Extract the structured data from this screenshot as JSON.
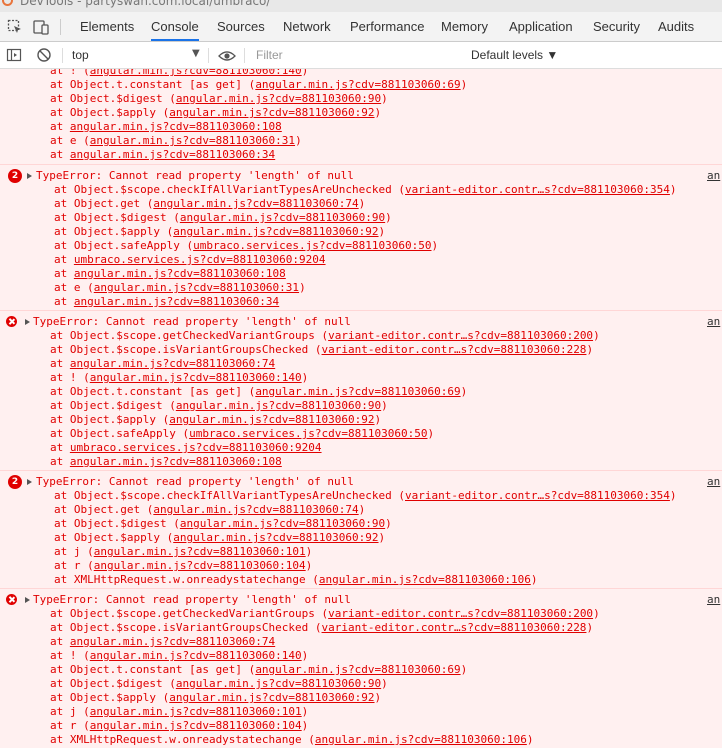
{
  "window": {
    "title": "DevTools - partyswan.com.local/umbraco/"
  },
  "tabs": [
    {
      "label": "Elements",
      "active": false
    },
    {
      "label": "Console",
      "active": true
    },
    {
      "label": "Sources",
      "active": false
    },
    {
      "label": "Network",
      "active": false
    },
    {
      "label": "Performance",
      "active": false
    },
    {
      "label": "Memory",
      "active": false
    },
    {
      "label": "Application",
      "active": false
    },
    {
      "label": "Security",
      "active": false
    },
    {
      "label": "Audits",
      "active": false
    }
  ],
  "toolbar": {
    "context": "top",
    "filter_placeholder": "Filter",
    "levels": "Default levels ▼"
  },
  "src_link": "an",
  "top_lines": [
    "at ! (angular.min.js?cdv=881103060:140)",
    "at Object.t.constant [as get] (angular.min.js?cdv=881103060:69)",
    "at Object.$digest (angular.min.js?cdv=881103060:90)",
    "at Object.$apply (angular.min.js?cdv=881103060:92)",
    "at angular.min.js?cdv=881103060:108",
    "at e (angular.min.js?cdv=881103060:31)",
    "at angular.min.js?cdv=881103060:34"
  ],
  "messages": [
    {
      "count": "2",
      "error": "TypeError: Cannot read property 'length' of null",
      "stack": [
        "at Object.$scope.checkIfAllVariantTypesAreUnchecked (variant-editor.contr…s?cdv=881103060:354)",
        "at Object.get (angular.min.js?cdv=881103060:74)",
        "at Object.$digest (angular.min.js?cdv=881103060:90)",
        "at Object.$apply (angular.min.js?cdv=881103060:92)",
        "at Object.safeApply (umbraco.services.js?cdv=881103060:50)",
        "at umbraco.services.js?cdv=881103060:9204",
        "at angular.min.js?cdv=881103060:108",
        "at e (angular.min.js?cdv=881103060:31)",
        "at angular.min.js?cdv=881103060:34"
      ]
    },
    {
      "count": "",
      "error": "TypeError: Cannot read property 'length' of null",
      "stack": [
        "at Object.$scope.getCheckedVariantGroups (variant-editor.contr…s?cdv=881103060:200)",
        "at Object.$scope.isVariantGroupsChecked (variant-editor.contr…s?cdv=881103060:228)",
        "at angular.min.js?cdv=881103060:74",
        "at ! (angular.min.js?cdv=881103060:140)",
        "at Object.t.constant [as get] (angular.min.js?cdv=881103060:69)",
        "at Object.$digest (angular.min.js?cdv=881103060:90)",
        "at Object.$apply (angular.min.js?cdv=881103060:92)",
        "at Object.safeApply (umbraco.services.js?cdv=881103060:50)",
        "at umbraco.services.js?cdv=881103060:9204",
        "at angular.min.js?cdv=881103060:108"
      ]
    },
    {
      "count": "2",
      "error": "TypeError: Cannot read property 'length' of null",
      "stack": [
        "at Object.$scope.checkIfAllVariantTypesAreUnchecked (variant-editor.contr…s?cdv=881103060:354)",
        "at Object.get (angular.min.js?cdv=881103060:74)",
        "at Object.$digest (angular.min.js?cdv=881103060:90)",
        "at Object.$apply (angular.min.js?cdv=881103060:92)",
        "at j (angular.min.js?cdv=881103060:101)",
        "at r (angular.min.js?cdv=881103060:104)",
        "at XMLHttpRequest.w.onreadystatechange (angular.min.js?cdv=881103060:106)"
      ]
    },
    {
      "count": "",
      "error": "TypeError: Cannot read property 'length' of null",
      "stack": [
        "at Object.$scope.getCheckedVariantGroups (variant-editor.contr…s?cdv=881103060:200)",
        "at Object.$scope.isVariantGroupsChecked (variant-editor.contr…s?cdv=881103060:228)",
        "at angular.min.js?cdv=881103060:74",
        "at ! (angular.min.js?cdv=881103060:140)",
        "at Object.t.constant [as get] (angular.min.js?cdv=881103060:69)",
        "at Object.$digest (angular.min.js?cdv=881103060:90)",
        "at Object.$apply (angular.min.js?cdv=881103060:92)",
        "at j (angular.min.js?cdv=881103060:101)",
        "at r (angular.min.js?cdv=881103060:104)",
        "at XMLHttpRequest.w.onreadystatechange (angular.min.js?cdv=881103060:106)"
      ]
    }
  ]
}
